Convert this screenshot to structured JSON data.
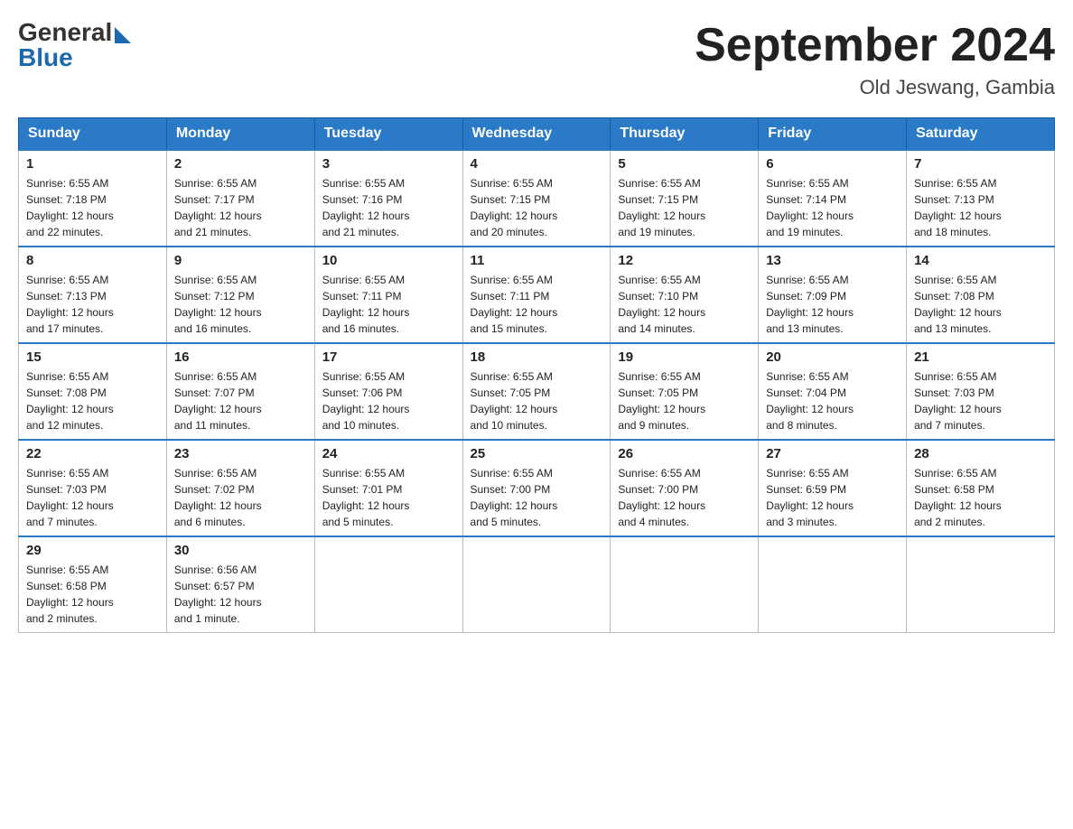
{
  "header": {
    "logo_general": "General",
    "logo_blue": "Blue",
    "title": "September 2024",
    "subtitle": "Old Jeswang, Gambia"
  },
  "calendar": {
    "days_of_week": [
      "Sunday",
      "Monday",
      "Tuesday",
      "Wednesday",
      "Thursday",
      "Friday",
      "Saturday"
    ],
    "weeks": [
      [
        {
          "day": "1",
          "sunrise": "6:55 AM",
          "sunset": "7:18 PM",
          "daylight": "12 hours and 22 minutes."
        },
        {
          "day": "2",
          "sunrise": "6:55 AM",
          "sunset": "7:17 PM",
          "daylight": "12 hours and 21 minutes."
        },
        {
          "day": "3",
          "sunrise": "6:55 AM",
          "sunset": "7:16 PM",
          "daylight": "12 hours and 21 minutes."
        },
        {
          "day": "4",
          "sunrise": "6:55 AM",
          "sunset": "7:15 PM",
          "daylight": "12 hours and 20 minutes."
        },
        {
          "day": "5",
          "sunrise": "6:55 AM",
          "sunset": "7:15 PM",
          "daylight": "12 hours and 19 minutes."
        },
        {
          "day": "6",
          "sunrise": "6:55 AM",
          "sunset": "7:14 PM",
          "daylight": "12 hours and 19 minutes."
        },
        {
          "day": "7",
          "sunrise": "6:55 AM",
          "sunset": "7:13 PM",
          "daylight": "12 hours and 18 minutes."
        }
      ],
      [
        {
          "day": "8",
          "sunrise": "6:55 AM",
          "sunset": "7:13 PM",
          "daylight": "12 hours and 17 minutes."
        },
        {
          "day": "9",
          "sunrise": "6:55 AM",
          "sunset": "7:12 PM",
          "daylight": "12 hours and 16 minutes."
        },
        {
          "day": "10",
          "sunrise": "6:55 AM",
          "sunset": "7:11 PM",
          "daylight": "12 hours and 16 minutes."
        },
        {
          "day": "11",
          "sunrise": "6:55 AM",
          "sunset": "7:11 PM",
          "daylight": "12 hours and 15 minutes."
        },
        {
          "day": "12",
          "sunrise": "6:55 AM",
          "sunset": "7:10 PM",
          "daylight": "12 hours and 14 minutes."
        },
        {
          "day": "13",
          "sunrise": "6:55 AM",
          "sunset": "7:09 PM",
          "daylight": "12 hours and 13 minutes."
        },
        {
          "day": "14",
          "sunrise": "6:55 AM",
          "sunset": "7:08 PM",
          "daylight": "12 hours and 13 minutes."
        }
      ],
      [
        {
          "day": "15",
          "sunrise": "6:55 AM",
          "sunset": "7:08 PM",
          "daylight": "12 hours and 12 minutes."
        },
        {
          "day": "16",
          "sunrise": "6:55 AM",
          "sunset": "7:07 PM",
          "daylight": "12 hours and 11 minutes."
        },
        {
          "day": "17",
          "sunrise": "6:55 AM",
          "sunset": "7:06 PM",
          "daylight": "12 hours and 10 minutes."
        },
        {
          "day": "18",
          "sunrise": "6:55 AM",
          "sunset": "7:05 PM",
          "daylight": "12 hours and 10 minutes."
        },
        {
          "day": "19",
          "sunrise": "6:55 AM",
          "sunset": "7:05 PM",
          "daylight": "12 hours and 9 minutes."
        },
        {
          "day": "20",
          "sunrise": "6:55 AM",
          "sunset": "7:04 PM",
          "daylight": "12 hours and 8 minutes."
        },
        {
          "day": "21",
          "sunrise": "6:55 AM",
          "sunset": "7:03 PM",
          "daylight": "12 hours and 7 minutes."
        }
      ],
      [
        {
          "day": "22",
          "sunrise": "6:55 AM",
          "sunset": "7:03 PM",
          "daylight": "12 hours and 7 minutes."
        },
        {
          "day": "23",
          "sunrise": "6:55 AM",
          "sunset": "7:02 PM",
          "daylight": "12 hours and 6 minutes."
        },
        {
          "day": "24",
          "sunrise": "6:55 AM",
          "sunset": "7:01 PM",
          "daylight": "12 hours and 5 minutes."
        },
        {
          "day": "25",
          "sunrise": "6:55 AM",
          "sunset": "7:00 PM",
          "daylight": "12 hours and 5 minutes."
        },
        {
          "day": "26",
          "sunrise": "6:55 AM",
          "sunset": "7:00 PM",
          "daylight": "12 hours and 4 minutes."
        },
        {
          "day": "27",
          "sunrise": "6:55 AM",
          "sunset": "6:59 PM",
          "daylight": "12 hours and 3 minutes."
        },
        {
          "day": "28",
          "sunrise": "6:55 AM",
          "sunset": "6:58 PM",
          "daylight": "12 hours and 2 minutes."
        }
      ],
      [
        {
          "day": "29",
          "sunrise": "6:55 AM",
          "sunset": "6:58 PM",
          "daylight": "12 hours and 2 minutes."
        },
        {
          "day": "30",
          "sunrise": "6:56 AM",
          "sunset": "6:57 PM",
          "daylight": "12 hours and 1 minute."
        },
        null,
        null,
        null,
        null,
        null
      ]
    ],
    "labels": {
      "sunrise": "Sunrise:",
      "sunset": "Sunset:",
      "daylight": "Daylight:"
    }
  }
}
